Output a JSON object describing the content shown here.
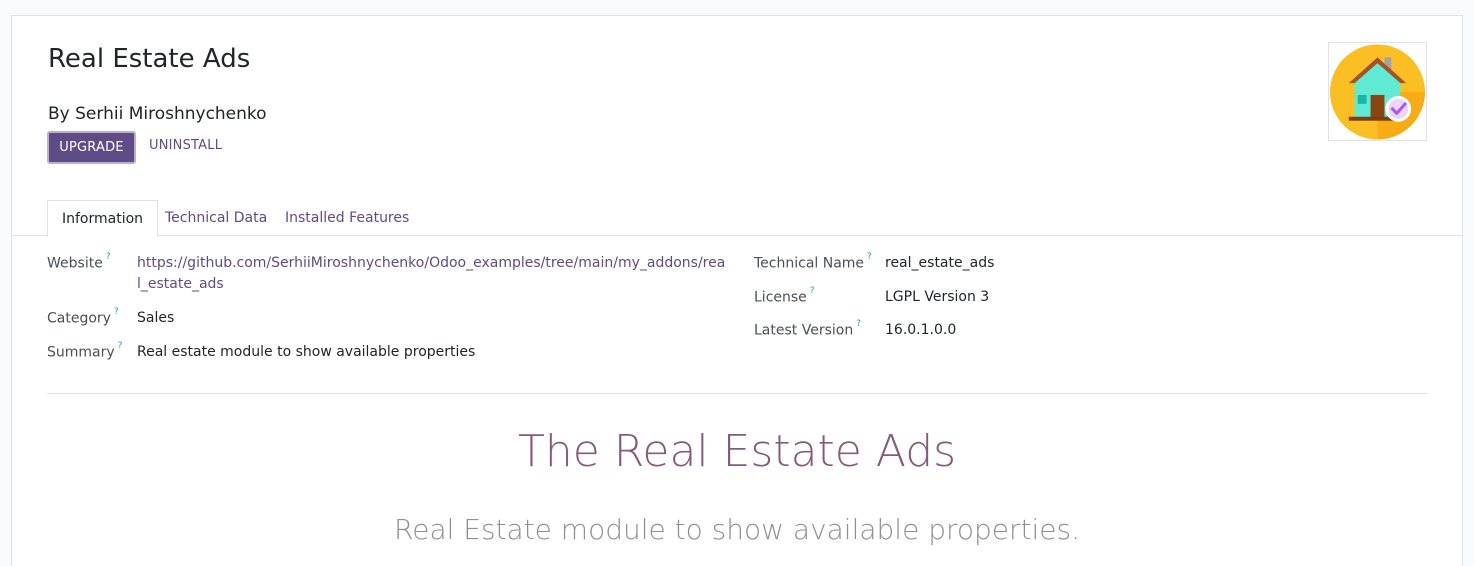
{
  "module": {
    "title": "Real Estate Ads",
    "author": "By Serhii Miroshnychenko",
    "upgrade_label": "UPGRADE",
    "uninstall_label": "UNINSTALL"
  },
  "tabs": [
    {
      "label": "Information"
    },
    {
      "label": "Technical Data"
    },
    {
      "label": "Installed Features"
    }
  ],
  "info": {
    "website_label": "Website",
    "website_value": "https://github.com/SerhiiMiroshnychenko/Odoo_examples/tree/main/my_addons/real_estate_ads",
    "category_label": "Category",
    "category_value": "Sales",
    "summary_label": "Summary",
    "summary_value": "Real estate module to show available properties",
    "technical_name_label": "Technical Name",
    "technical_name_value": "real_estate_ads",
    "license_label": "License",
    "license_value": "LGPL Version 3",
    "latest_version_label": "Latest Version",
    "latest_version_value": "16.0.1.0.0",
    "help_marker": "?"
  },
  "description": {
    "heading": "The Real Estate Ads",
    "subheading": "Real Estate module to show available properties."
  },
  "colors": {
    "primary": "#5f4b85",
    "heading": "#875a7b",
    "icon_bg": "#fbbf24"
  }
}
